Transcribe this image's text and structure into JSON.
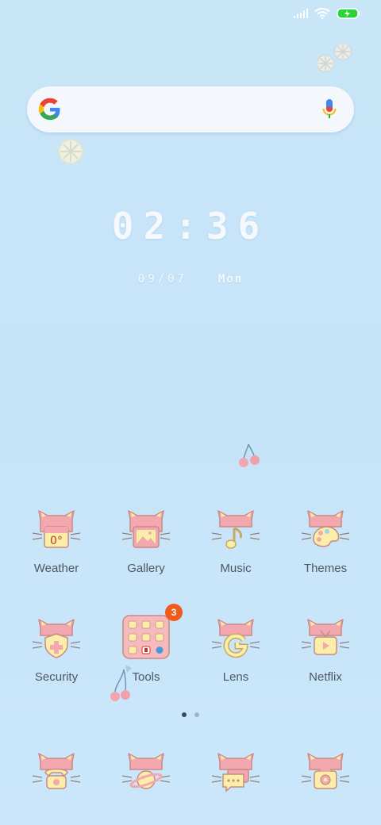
{
  "status_bar": {
    "signal_icon": "signal-bars-icon",
    "wifi_icon": "wifi-icon",
    "battery_icon": "battery-charging-icon",
    "battery_color": "#2fd13b"
  },
  "search_bar": {
    "logo_icon": "google-g-icon",
    "mic_icon": "microphone-icon"
  },
  "clock": {
    "time": "02:36",
    "date": "09/07",
    "day": "Mon"
  },
  "home_grid": {
    "row1": [
      {
        "label": "Weather",
        "icon": "weather-cat-icon"
      },
      {
        "label": "Gallery",
        "icon": "gallery-cat-icon"
      },
      {
        "label": "Music",
        "icon": "music-cat-icon"
      },
      {
        "label": "Themes",
        "icon": "themes-cat-icon"
      }
    ],
    "row2": [
      {
        "label": "Security",
        "icon": "security-cat-icon"
      },
      {
        "label": "Tools",
        "icon": "tools-folder-icon",
        "badge": "3"
      },
      {
        "label": "Lens",
        "icon": "lens-cat-icon"
      },
      {
        "label": "Netflix",
        "icon": "netflix-cat-icon"
      }
    ]
  },
  "page_indicator": {
    "pages": 2,
    "active": 1
  },
  "dock": [
    {
      "icon": "phone-cat-icon"
    },
    {
      "icon": "browser-cat-icon"
    },
    {
      "icon": "messages-cat-icon"
    },
    {
      "icon": "camera-cat-icon"
    }
  ],
  "colors": {
    "background": "#c9e5f8",
    "cat_pink": "#f3a7ae",
    "cat_yellow": "#fbeea9",
    "outline": "#c98a83",
    "badge": "#f05a1c"
  }
}
